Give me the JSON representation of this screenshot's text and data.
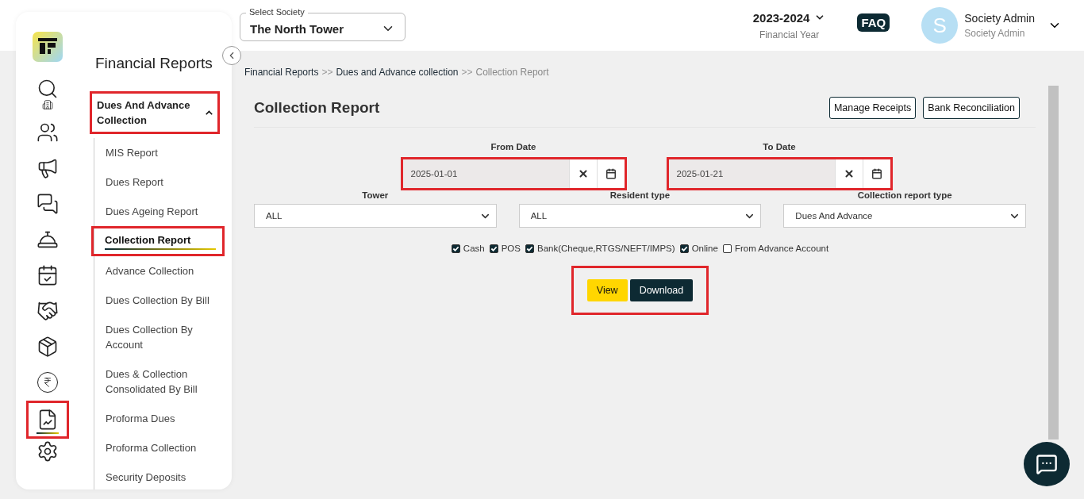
{
  "icon_rail": [
    {
      "selected": false,
      "highlighted": false
    },
    {
      "selected": false,
      "highlighted": false
    },
    {
      "selected": false,
      "highlighted": false
    },
    {
      "selected": false,
      "highlighted": false
    },
    {
      "selected": false,
      "highlighted": false
    },
    {
      "selected": false,
      "highlighted": false
    },
    {
      "selected": false,
      "highlighted": false
    },
    {
      "selected": false,
      "highlighted": false
    },
    {
      "selected": false,
      "highlighted": false
    },
    {
      "selected": false,
      "highlighted": false
    },
    {
      "selected": true,
      "highlighted": true
    },
    {
      "selected": false,
      "highlighted": false
    }
  ],
  "sidebar": {
    "title": "Financial Reports",
    "group": {
      "label": "Dues And Advance Collection",
      "expanded": true,
      "highlighted": true
    },
    "items": [
      {
        "label": "MIS Report",
        "selected": false,
        "highlighted": false
      },
      {
        "label": "Dues Report",
        "selected": false,
        "highlighted": false
      },
      {
        "label": "Dues Ageing Report",
        "selected": false,
        "highlighted": false
      },
      {
        "label": "Collection Report",
        "selected": true,
        "highlighted": true
      },
      {
        "label": "Advance Collection",
        "selected": false,
        "highlighted": false
      },
      {
        "label": "Dues Collection By Bill",
        "selected": false,
        "highlighted": false
      },
      {
        "label": "Dues Collection By Account",
        "selected": false,
        "highlighted": false
      },
      {
        "label": "Dues & Collection Consolidated By Bill",
        "selected": false,
        "highlighted": false
      },
      {
        "label": "Proforma Dues",
        "selected": false,
        "highlighted": false
      },
      {
        "label": "Proforma Collection",
        "selected": false,
        "highlighted": false
      },
      {
        "label": "Security Deposits",
        "selected": false,
        "highlighted": false
      }
    ]
  },
  "topbar": {
    "society": {
      "label": "Select Society",
      "value": "The North Tower"
    },
    "year": {
      "value": "2023-2024",
      "label": "Financial Year"
    },
    "faq": "FAQ",
    "user": {
      "initial": "S",
      "name": "Society Admin",
      "role": "Society Admin"
    }
  },
  "breadcrumb": [
    {
      "label": "Financial Reports",
      "current": false
    },
    {
      "label": "Dues and Advance collection",
      "current": false
    },
    {
      "label": "Collection Report",
      "current": true
    }
  ],
  "breadcrumb_separator": ">>",
  "page": {
    "title": "Collection Report",
    "actions": [
      "Manage Receipts",
      "Bank Reconciliation"
    ],
    "dates": [
      {
        "label": "From Date",
        "value": "2025-01-01",
        "highlighted": true
      },
      {
        "label": "To Date",
        "value": "2025-01-21",
        "highlighted": true
      }
    ],
    "selects": [
      {
        "label": "Tower",
        "value": "ALL"
      },
      {
        "label": "Resident type",
        "value": "ALL"
      },
      {
        "label": "Collection report type",
        "value": "Dues And Advance"
      }
    ],
    "payment_modes": [
      {
        "label": "Cash",
        "checked": true
      },
      {
        "label": "POS",
        "checked": true
      },
      {
        "label": "Bank(Cheque,RTGS/NEFT/IMPS)",
        "checked": true
      },
      {
        "label": "Online",
        "checked": true
      },
      {
        "label": "From Advance Account",
        "checked": false
      }
    ],
    "buttons": {
      "highlighted": true,
      "items": [
        {
          "label": "View",
          "kind": "primary"
        },
        {
          "label": "Download",
          "kind": "dark"
        }
      ]
    }
  }
}
